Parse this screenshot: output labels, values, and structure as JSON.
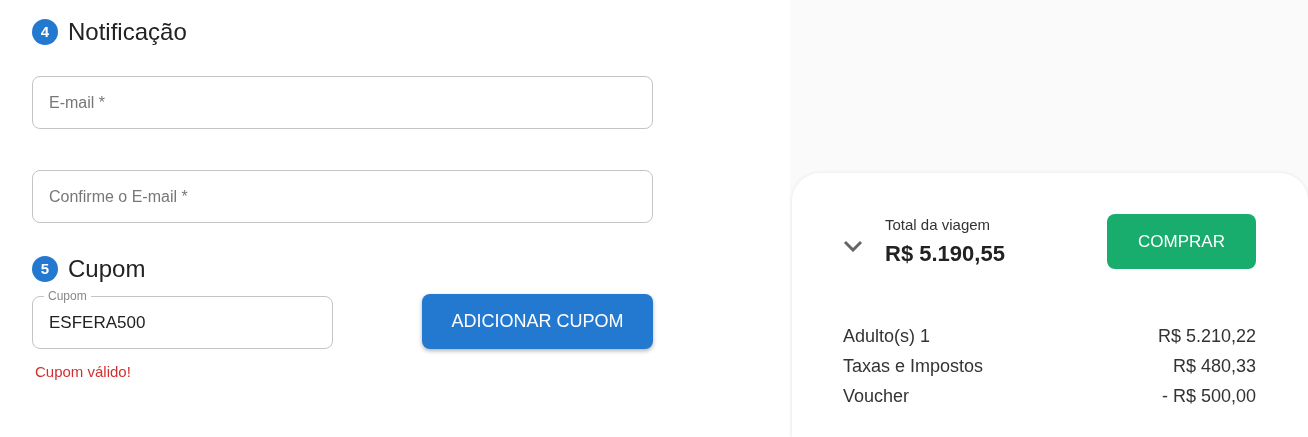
{
  "notification": {
    "step": "4",
    "title": "Notificação",
    "fields": [
      {
        "placeholder": "E-mail *"
      },
      {
        "placeholder": "Confirme o E-mail *"
      }
    ]
  },
  "coupon": {
    "step": "5",
    "title": "Cupom",
    "field": {
      "label": "Cupom",
      "value": "ESFERA500"
    },
    "message": "Cupom válido!",
    "button": "ADICIONAR CUPOM"
  },
  "summary": {
    "total_label": "Total da viagem",
    "total": "R$ 5.190,55",
    "expanded": true,
    "button": "COMPRAR",
    "rows": [
      {
        "label": "Adulto(s) 1",
        "value": "R$ 5.210,22"
      },
      {
        "label": "Taxas e Impostos",
        "value": "R$ 480,33"
      },
      {
        "label": "Voucher",
        "value": "- R$ 500,00"
      }
    ]
  }
}
